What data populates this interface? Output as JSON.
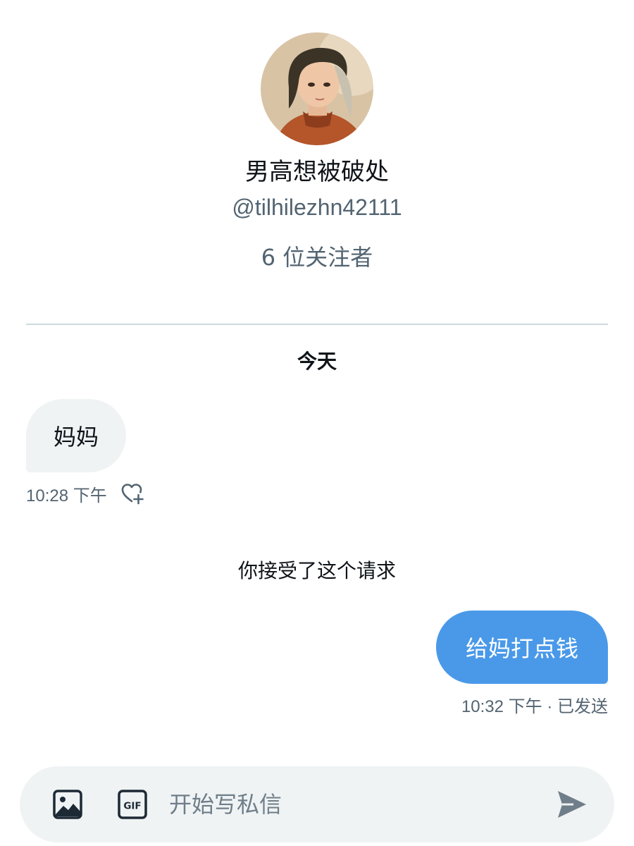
{
  "profile": {
    "display_name": "男高想被破处",
    "handle": "@tilhilezhn42111",
    "followers": "6 位关注者"
  },
  "conversation": {
    "day_label": "今天",
    "messages": [
      {
        "direction": "incoming",
        "text": "妈妈",
        "time": "10:28 下午"
      },
      {
        "direction": "outgoing",
        "text": "给妈打点钱",
        "meta": "10:32 下午 · 已发送"
      }
    ],
    "system_note": "你接受了这个请求"
  },
  "composer": {
    "placeholder": "开始写私信",
    "image_icon": "image-icon",
    "gif_icon": "gif-icon",
    "send_icon": "send-icon"
  },
  "colors": {
    "outgoing_bubble": "#4a99e9",
    "incoming_bubble": "#eff3f4",
    "secondary_text": "#536471",
    "divider": "#cfd9de"
  }
}
